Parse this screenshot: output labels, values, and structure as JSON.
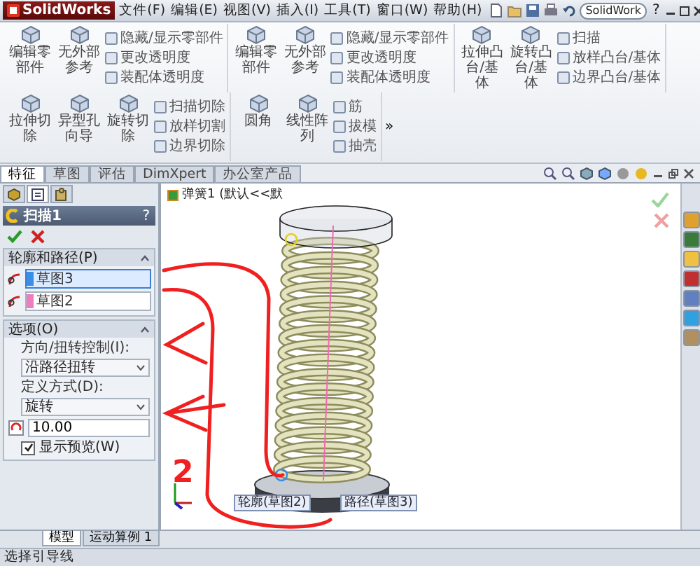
{
  "window": {
    "app": "SolidWorks",
    "menus": [
      "文件(F)",
      "编辑(E)",
      "视图(V)",
      "插入(I)",
      "工具(T)",
      "窗口(W)",
      "帮助(H)"
    ],
    "search": {
      "value": "SolidWork"
    },
    "help": "?"
  },
  "ribbon": {
    "groups": [
      {
        "items": [
          {
            "kind": "large",
            "label": "编辑零部件"
          },
          {
            "kind": "large",
            "label": "无外部参考"
          },
          {
            "kind": "small",
            "label": "隐藏/显示零部件"
          },
          {
            "kind": "small",
            "label": "更改透明度"
          },
          {
            "kind": "small",
            "label": "装配体透明度"
          }
        ]
      },
      {
        "items": [
          {
            "kind": "large",
            "label": "编辑零部件"
          },
          {
            "kind": "large",
            "label": "无外部参考"
          },
          {
            "kind": "small",
            "label": "隐藏/显示零部件"
          },
          {
            "kind": "small",
            "label": "更改透明度"
          },
          {
            "kind": "small",
            "label": "装配体透明度"
          }
        ]
      },
      {
        "items": [
          {
            "kind": "large",
            "label": "拉伸凸台/基体"
          },
          {
            "kind": "large",
            "label": "旋转凸台/基体"
          },
          {
            "kind": "small",
            "label": "扫描"
          },
          {
            "kind": "small",
            "label": "放样凸台/基体"
          },
          {
            "kind": "small",
            "label": "边界凸台/基体"
          }
        ]
      },
      {
        "items": [
          {
            "kind": "large",
            "label": "拉伸切除"
          },
          {
            "kind": "large",
            "label": "异型孔向导"
          },
          {
            "kind": "large",
            "label": "旋转切除"
          },
          {
            "kind": "small",
            "label": "扫描切除"
          },
          {
            "kind": "small",
            "label": "放样切割"
          },
          {
            "kind": "small",
            "label": "边界切除"
          }
        ]
      },
      {
        "items": [
          {
            "kind": "large",
            "label": "圆角"
          },
          {
            "kind": "large",
            "label": "线性阵列"
          },
          {
            "kind": "small",
            "label": "筋"
          },
          {
            "kind": "small",
            "label": "拔模"
          },
          {
            "kind": "small",
            "label": "抽壳"
          }
        ]
      }
    ],
    "more": "»"
  },
  "command_tabs": [
    {
      "label": "特征",
      "selected": true
    },
    {
      "label": "草图",
      "selected": false
    },
    {
      "label": "评估",
      "selected": false
    },
    {
      "label": "DimXpert",
      "selected": false
    },
    {
      "label": "办公室产品",
      "selected": false
    }
  ],
  "property_manager": {
    "tabs": [
      {
        "selected": false
      },
      {
        "selected": true
      },
      {
        "selected": false
      }
    ],
    "title": "扫描1",
    "help": "?",
    "sections": [
      {
        "kind": "selections",
        "title": "轮廓和路径(P)",
        "expanded": true,
        "fields": [
          {
            "value": "草图3",
            "color": "#3a8ee6",
            "selected": true
          },
          {
            "value": "草图2",
            "color": "#f07cc0",
            "selected": false
          }
        ]
      },
      {
        "kind": "options",
        "title": "选项(O)",
        "expanded": true,
        "controls": [
          {
            "kind": "label",
            "text": "方向/扭转控制(I):"
          },
          {
            "kind": "dropdown",
            "value": "沿路径扭转"
          },
          {
            "kind": "label",
            "text": "定义方式(D):"
          },
          {
            "kind": "dropdown",
            "value": "旋转"
          },
          {
            "kind": "number",
            "value": "10.00"
          },
          {
            "kind": "checkbox",
            "label": "显示预览(W)",
            "checked": true
          }
        ]
      }
    ]
  },
  "viewport": {
    "tree_item": "弹簧1 (默认<<默",
    "sketch_labels": [
      "轮廓(草图2)",
      "路径(草图3)"
    ],
    "annotation": "2"
  },
  "bottom_tabs": [
    {
      "label": "模型",
      "selected": true
    },
    {
      "label": "运动算例 1",
      "selected": false
    }
  ],
  "status_bar": "选择引导线"
}
